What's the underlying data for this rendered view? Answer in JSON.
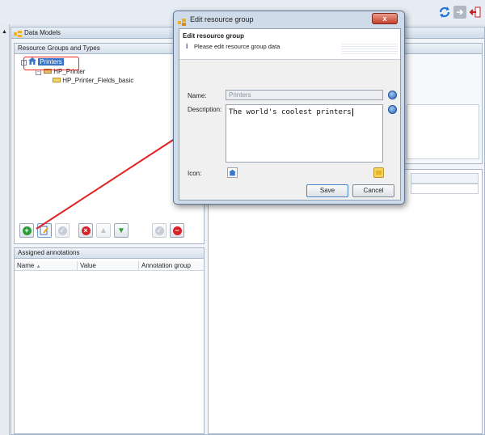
{
  "data_models": {
    "title": "Data Models",
    "resource_panel": {
      "title": "Resource Groups and Types",
      "tree": [
        {
          "label": "Printers"
        },
        {
          "label": "HP_Printer"
        },
        {
          "label": "HP_Printer_Fields_basic"
        }
      ]
    },
    "annotations_panel": {
      "title": "Assigned annotations",
      "columns": [
        "Name",
        "Value",
        "Annotation group"
      ]
    }
  },
  "dialog": {
    "title": "Edit resource group",
    "banner_title": "Edit resource group",
    "banner_info": "Please edit resource group data",
    "close_label": "x",
    "name_label": "Name:",
    "name_value": "Printers",
    "description_label": "Description:",
    "description_value": "The world's coolest printers",
    "icon_label": "Icon:",
    "save_label": "Save",
    "cancel_label": "Cancel"
  },
  "colors": {
    "annotation_red": "#e22222",
    "selection_blue": "#3a74c8"
  }
}
